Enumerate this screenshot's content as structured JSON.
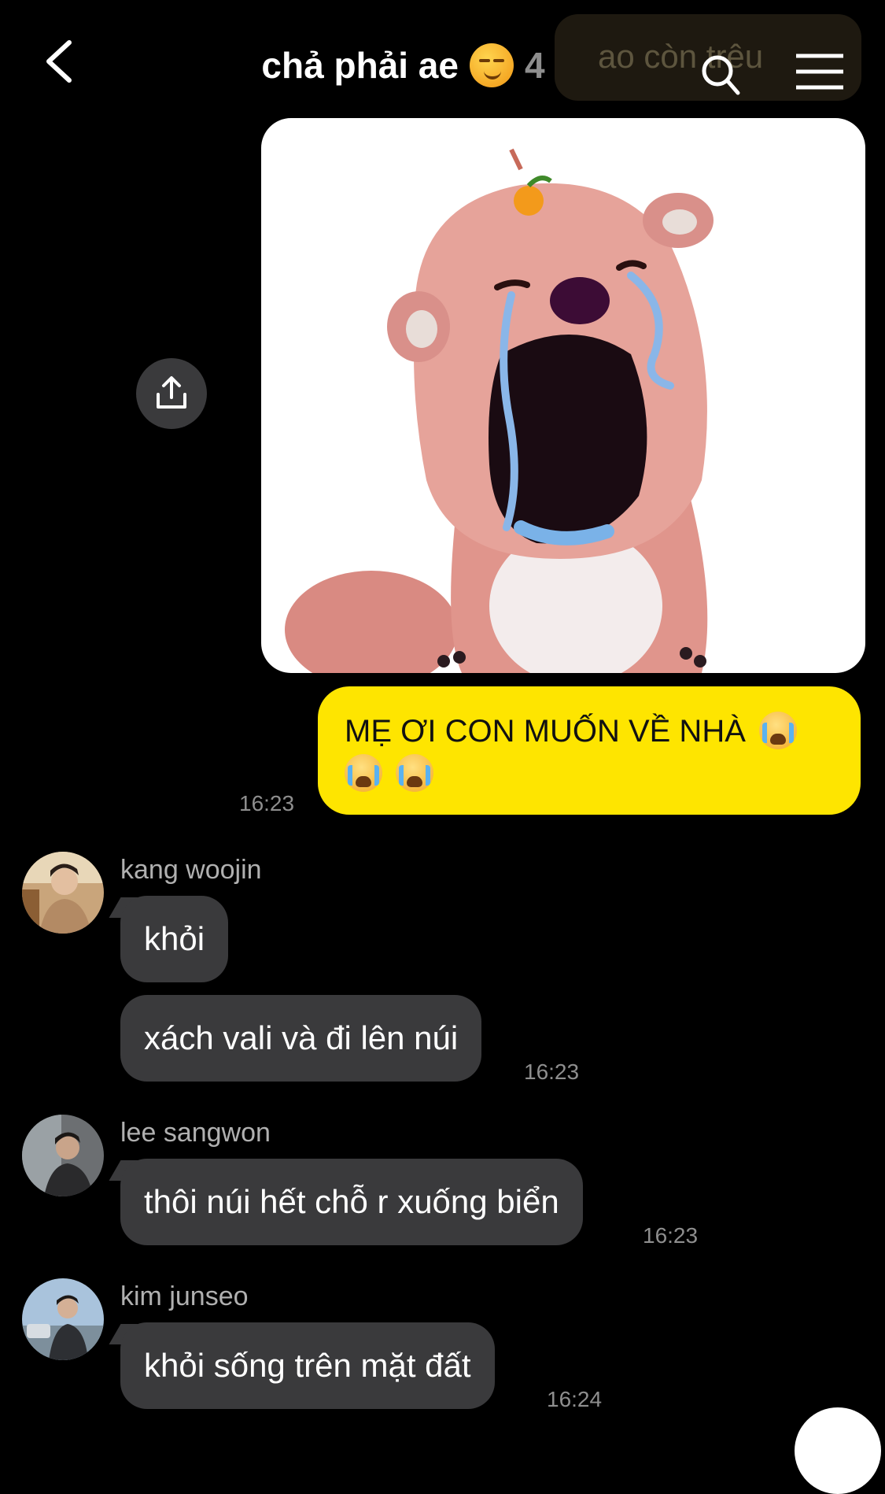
{
  "header": {
    "title": "chả phải ae",
    "member_count": "4",
    "ghost_preview_text": "ao còn trêu"
  },
  "messages": {
    "mine": {
      "text_line1": "MẸ ƠI CON MUỐN VỀ NHÀ",
      "time": "16:23"
    },
    "kang": {
      "sender": "kang woojin",
      "msg1": "khỏi",
      "msg2": "xách vali và đi lên núi",
      "time": "16:23"
    },
    "lee": {
      "sender": "lee sangwon",
      "msg1": "thôi núi hết chỗ r xuống biển",
      "time": "16:23"
    },
    "kim": {
      "sender": "kim junseo",
      "msg1": "khỏi sống trên mặt đất",
      "time": "16:24"
    }
  },
  "colors": {
    "my_bubble": "#fee500",
    "other_bubble": "#3a3a3c",
    "background": "#000000",
    "timestamp": "#8e8e8e"
  },
  "icons": [
    "back-icon",
    "smirk-emoji-icon",
    "search-icon",
    "menu-icon",
    "share-icon",
    "loudly-crying-emoji-icon"
  ]
}
